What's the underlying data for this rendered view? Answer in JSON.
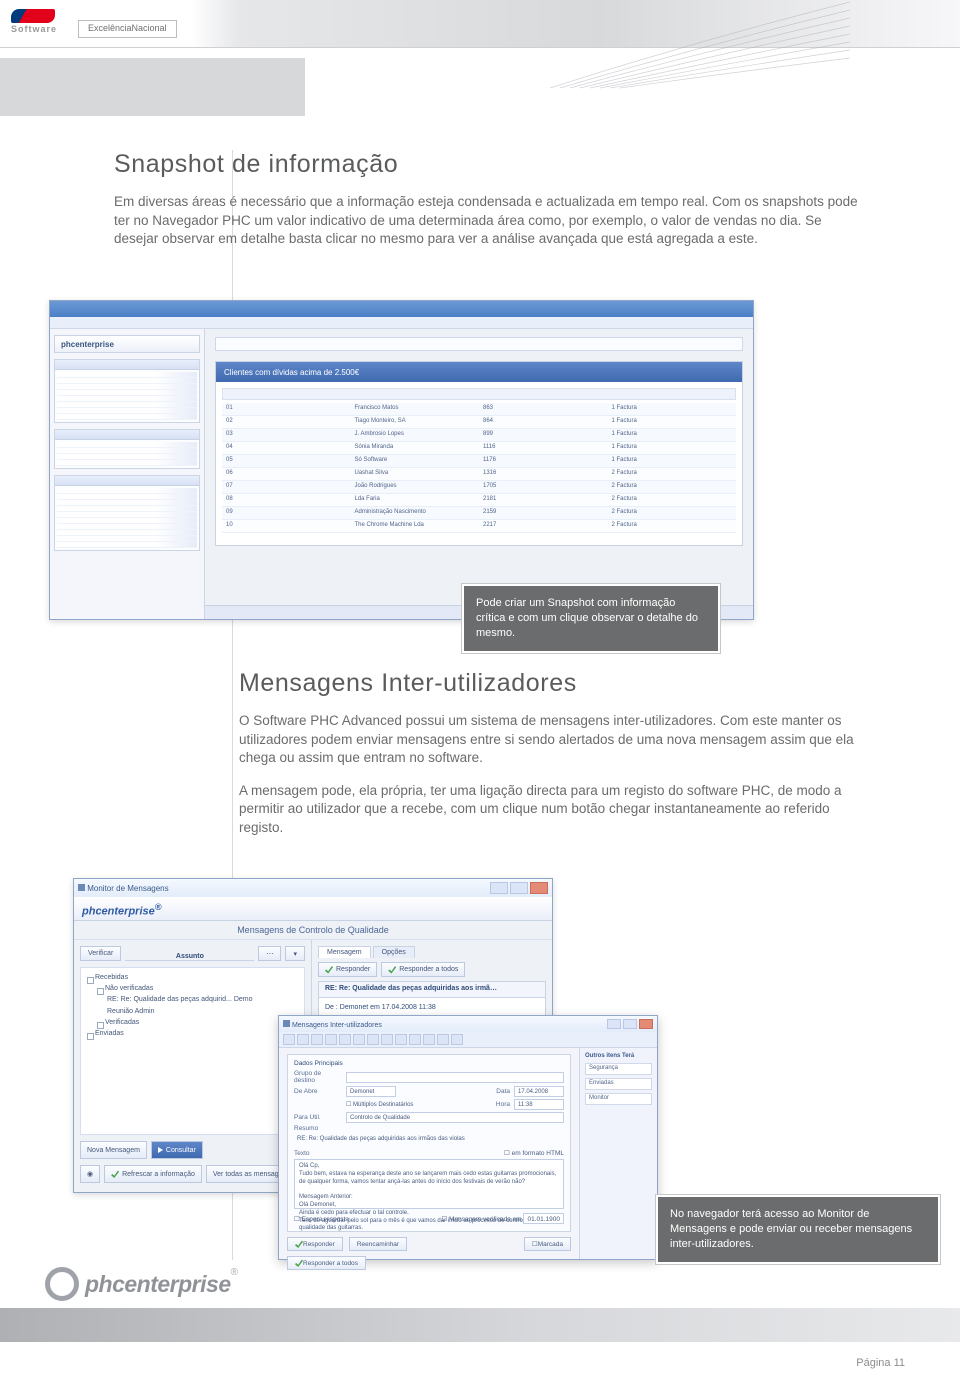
{
  "header": {
    "brand_software": "Software",
    "badge": "ExcelênciaNacional"
  },
  "section1": {
    "title": "Snapshot de informação",
    "para": "Em diversas áreas é necessário que a informação esteja condensada e actualizada em tempo real. Com os snapshots pode ter no Navegador PHC um valor indicativo de uma determinada área como, por exemplo, o valor de vendas no dia. Se desejar observar em detalhe basta clicar no mesmo para ver a análise avançada que está agregada a este."
  },
  "sshot1": {
    "brand": "phcenterprise",
    "panel_title": "Clientes com dívidas acima de 2.500€",
    "rows": [
      [
        "01",
        "Francisco Matos",
        "863",
        "1 Factura"
      ],
      [
        "02",
        "Tiago Monteiro, SA",
        "864",
        "1 Factura"
      ],
      [
        "03",
        "J. Ambrosio Lopes",
        "899",
        "1 Factura"
      ],
      [
        "04",
        "Sónia Miranda",
        "1116",
        "1 Factura"
      ],
      [
        "05",
        "Só Software",
        "1176",
        "1 Factura"
      ],
      [
        "06",
        "Uashat Silva",
        "1316",
        "2 Factura"
      ],
      [
        "07",
        "João Rodrigues",
        "1705",
        "2 Factura"
      ],
      [
        "08",
        "Lda Faria",
        "2181",
        "2 Factura"
      ],
      [
        "09",
        "Administração Nascimento",
        "2159",
        "2 Factura"
      ],
      [
        "10",
        "The Chrome Machine Lda",
        "2217",
        "2 Factura"
      ]
    ]
  },
  "callout1": "Pode criar um Snapshot com informação crítica e com um clique observar o detalhe do mesmo.",
  "section2": {
    "title": "Mensagens Inter-utilizadores",
    "para1": "O Software PHC Advanced possui um sistema de mensagens inter-utilizadores. Com este manter os utilizadores podem enviar mensagens entre si sendo alertados de uma nova mensagem assim que ela chega ou assim que entram no software.",
    "para2": "A mensagem pode, ela própria, ter uma ligação directa para um registo do software PHC, de modo a permitir ao utilizador que a recebe, com um clique num botão chegar instantaneamente ao referido registo."
  },
  "sshot2": {
    "window_title": "Monitor de Mensagens",
    "brand": "phcenterprise",
    "center_label": "Mensagens de Controlo de Qualidade",
    "verify_btn": "Verificar",
    "assunto_label": "Assunto",
    "tree": {
      "recebidas": "Recebidas",
      "nao_verificadas": "Não verificadas",
      "leaf1": "RE: Re: Qualidade das peças adquirid...  Demo",
      "leaf2": "Reunião                                       Admin",
      "verificadas": "Verificadas",
      "enviadas": "Enviadas"
    },
    "nova_btn": "Nova Mensagem",
    "consultar_btn": "Consultar",
    "refrescar_btn": "Refrescar a informação",
    "vertodas_btn": "Ver todas as mensagens",
    "tabs": {
      "mensagem": "Mensagem",
      "opcoes": "Opções"
    },
    "reply_btn": "Responder",
    "replyall_btn": "Responder a todos",
    "subject": "RE: Re: Qualidade das peças adquiridas aos irmã…",
    "from_line": "De : Demonet em 17.04.2008 11:38",
    "body_lines": [
      "Olá Cp,",
      "Tudo bem, estava na esperança deste ano se lançarem mais cedo estas guitarras promocionais, de qualquer forma, vamos tentar ançá-las antes do início dos festivais de verão não?",
      "",
      "Mensagem Anterior:",
      "Olá Demonet,",
      "Ainda é cedo para efectuar o tal controle.",
      "Tens de aguardar pelo sol para o mês é que vamos dar início ao processo de controlo de qualidade das"
    ]
  },
  "sshot3": {
    "window_title": "Mensagens Inter-utilizadores",
    "group_label": "Dados Principais",
    "side_header": "Outros itens Terá",
    "side_items": [
      "Segurança",
      "Enviadas",
      "Monitor"
    ],
    "fields": {
      "grupo": "Grupo de destino",
      "de": "De  Abre",
      "de_val": "Demonet",
      "data_label": "Data",
      "data_val": "17.04.2008",
      "hora_label": "Hora",
      "hora_val": "11:38",
      "multiplos": "Múltiplos Destinatários",
      "para": "Para  Util.",
      "para_val": "Controlo de Qualidade",
      "resumo": "Resumo",
      "resumo_val": "RE: Re: Qualidade das peças adquiridas aos irmãos das violas",
      "texto": "Texto",
      "html_chk": "em formato HTML",
      "body": "Olá Cp,\nTudo bem, estava na esperança deste ano se lançarem mais cedo estas guitarras promocionais, de qualquer forma, vamos tentar ançá-las antes do início dos festivais de verão não?\n\nMensagem Anterior:\nOlá Demonet,\nAinda é cedo para efectuar o tal controle.\nTens de aguardar pelo sol para o mês é que vamos dar início ao processo de controlo de qualidade das guitarras.",
      "espera": "Espera resposta",
      "verif": "Mensagem verificada em",
      "verif_val": "01.01.1900",
      "responder": "Responder",
      "reencaminhar": "Reencaminhar",
      "responder_todos": "Responder a todos",
      "marcada": "Marcada"
    }
  },
  "callout2": "No navegador terá acesso ao Monitor de Mensagens e pode enviar ou receber mensagens inter-utilizadores.",
  "footer": {
    "brand": "phcenterprise",
    "page": "Página 11"
  }
}
